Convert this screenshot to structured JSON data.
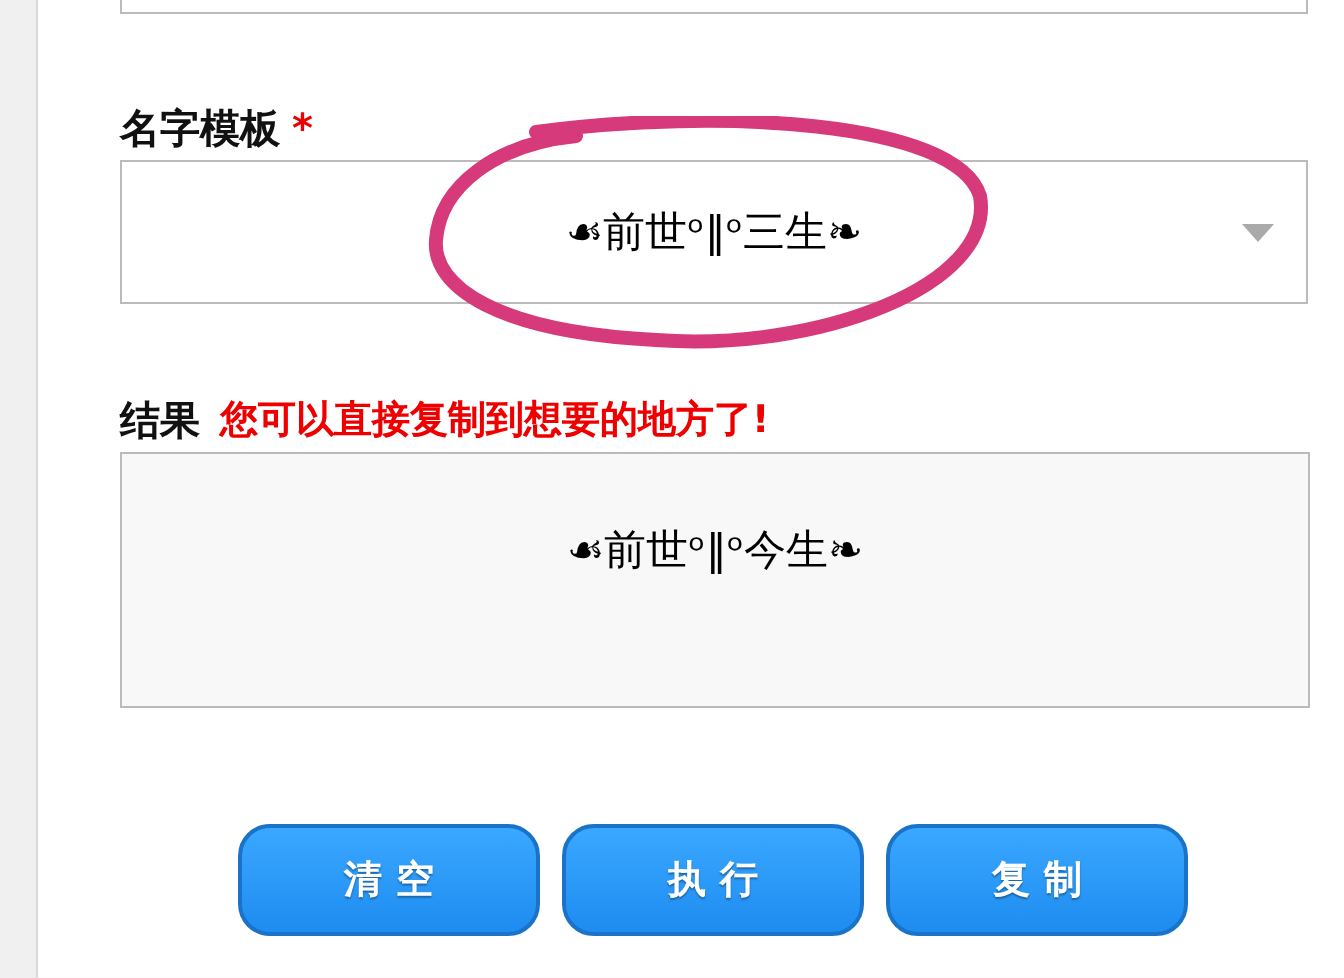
{
  "template_field": {
    "label": "名字模板",
    "required_mark": "*",
    "value": "☙前世ᵒ‖ᵒ三生❧"
  },
  "result": {
    "label": "结果",
    "hint": "您可以直接复制到想要的地方了!",
    "value": "☙前世ᵒ‖ᵒ今生❧"
  },
  "buttons": [
    "清 空",
    "执 行",
    "复 制"
  ]
}
